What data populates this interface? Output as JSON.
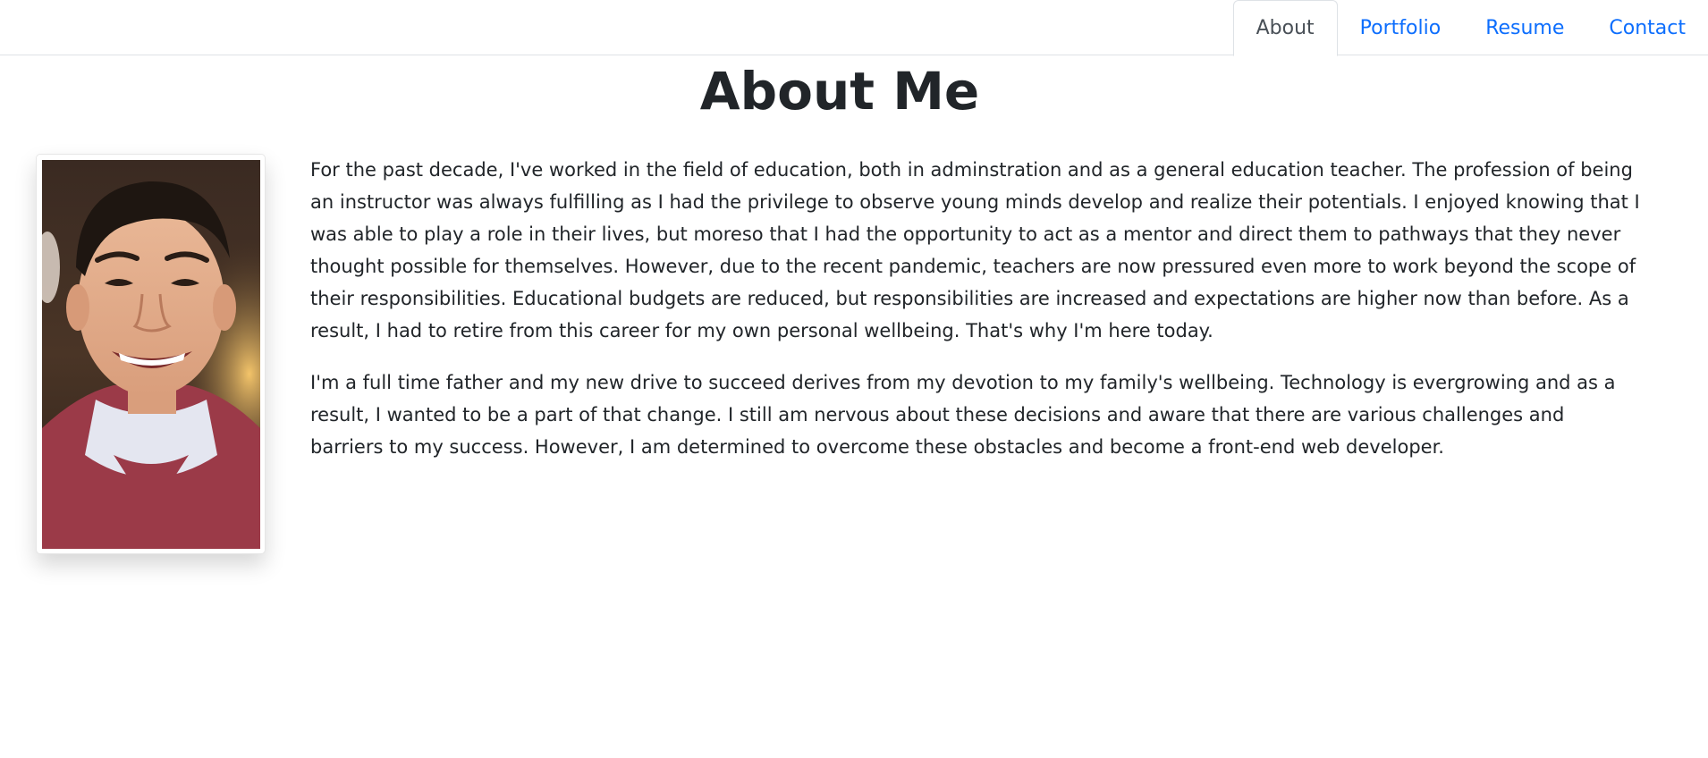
{
  "nav": {
    "tabs": [
      {
        "label": "About",
        "active": true
      },
      {
        "label": "Portfolio",
        "active": false
      },
      {
        "label": "Resume",
        "active": false
      },
      {
        "label": "Contact",
        "active": false
      }
    ]
  },
  "page": {
    "title": "About Me"
  },
  "bio": {
    "paragraphs": [
      "For the past decade, I've worked in the field of education, both in adminstration and as a general education teacher. The profession of being an instructor was always fulfilling as I had the privilege to observe young minds develop and realize their potentials. I enjoyed knowing that I was able to play a role in their lives, but moreso that I had the opportunity to act as a mentor and direct them to pathways that they never thought possible for themselves. However, due to the recent pandemic, teachers are now pressured even more to work beyond the scope of their responsibilities. Educational budgets are reduced, but responsibilities are increased and expectations are higher now than before. As a result, I had to retire from this career for my own personal wellbeing. That's why I'm here today.",
      "I'm a full time father and my new drive to succeed derives from my devotion to my family's wellbeing. Technology is evergrowing and as a result, I wanted to be a part of that change. I still am nervous about these decisions and aware that there are various challenges and barriers to my success. However, I am determined to overcome these obstacles and become a front-end web developer."
    ]
  },
  "colors": {
    "link": "#0d6efd",
    "active_tab_text": "#495057",
    "text": "#212529",
    "border": "#dee2e6"
  }
}
